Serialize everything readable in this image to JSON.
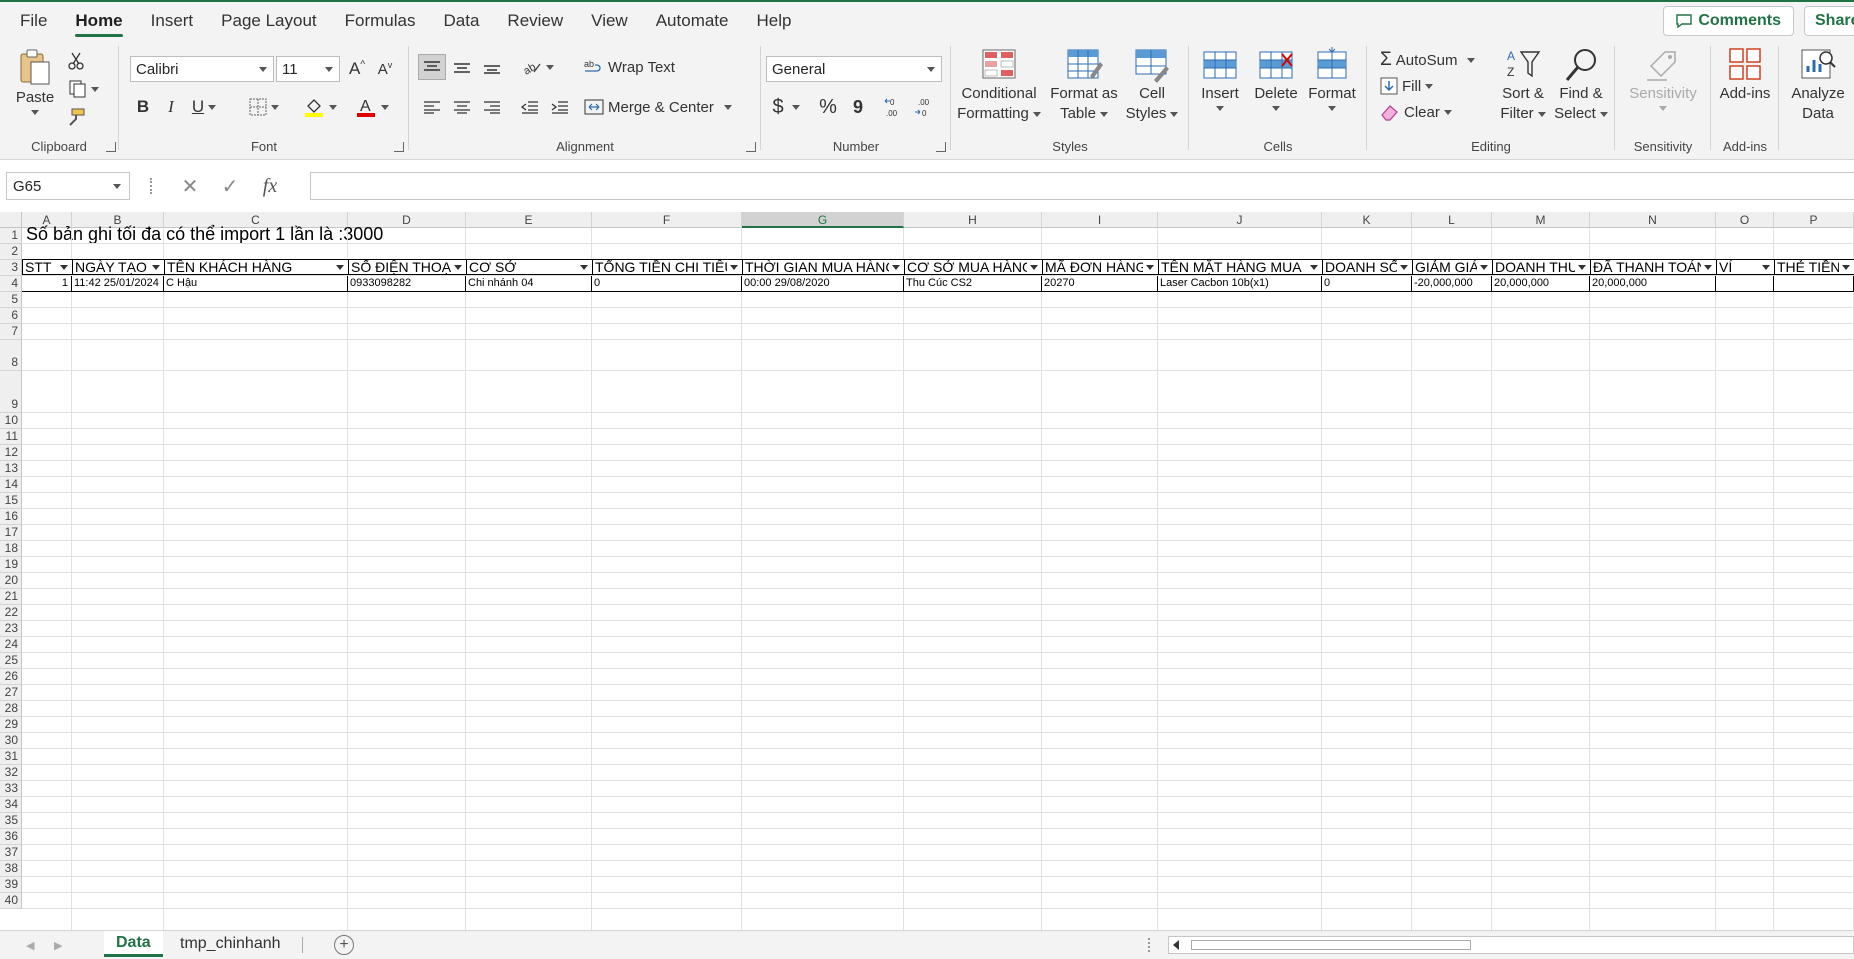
{
  "menu": {
    "tabs": [
      "File",
      "Home",
      "Insert",
      "Page Layout",
      "Formulas",
      "Data",
      "Review",
      "View",
      "Automate",
      "Help"
    ],
    "active_tab": "Home",
    "comments_label": "Comments",
    "share_label": "Share"
  },
  "ribbon": {
    "clipboard": {
      "paste": "Paste",
      "label": "Clipboard"
    },
    "font": {
      "name": "Calibri",
      "size": "11",
      "bold": "B",
      "italic": "I",
      "underline": "U",
      "label": "Font"
    },
    "alignment": {
      "wrap_text": "Wrap Text",
      "merge_center": "Merge & Center",
      "label": "Alignment"
    },
    "number": {
      "format": "General",
      "currency": "$",
      "percent": "%",
      "comma": "9",
      "label": "Number"
    },
    "styles": {
      "conditional_1": "Conditional",
      "conditional_2": "Formatting",
      "format_table_1": "Format as",
      "format_table_2": "Table",
      "cell_styles_1": "Cell",
      "cell_styles_2": "Styles",
      "label": "Styles"
    },
    "cells": {
      "insert": "Insert",
      "delete": "Delete",
      "format": "Format",
      "label": "Cells"
    },
    "editing": {
      "autosum": "AutoSum",
      "fill": "Fill",
      "clear": "Clear",
      "sort_1": "Sort &",
      "sort_2": "Filter",
      "find_1": "Find &",
      "find_2": "Select",
      "label": "Editing"
    },
    "sensitivity": {
      "button": "Sensitivity",
      "label": "Sensitivity"
    },
    "addins": {
      "button": "Add-ins",
      "label": "Add-ins"
    },
    "analyze": {
      "line1": "Analyze",
      "line2": "Data"
    }
  },
  "formula_bar": {
    "name_box": "G65",
    "fx": "fx",
    "content": ""
  },
  "sheet": {
    "columns": [
      "A",
      "B",
      "C",
      "D",
      "E",
      "F",
      "G",
      "H",
      "I",
      "J",
      "K",
      "L",
      "M",
      "N",
      "O",
      "P"
    ],
    "selected_column": "G",
    "rows": [
      "1",
      "2",
      "3",
      "4",
      "5",
      "6",
      "7",
      "8",
      "9",
      "10",
      "11",
      "12",
      "13",
      "14",
      "15",
      "16",
      "17",
      "18",
      "19",
      "20",
      "21",
      "22",
      "23",
      "24",
      "25",
      "26",
      "27",
      "28",
      "29",
      "30",
      "31",
      "32",
      "33",
      "34",
      "35",
      "36",
      "37",
      "38",
      "39",
      "40"
    ],
    "title": "Số bản ghi tối đa có thể import 1 lần là :3000",
    "headers": [
      "STT",
      "NGÀY TẠO",
      "TÊN KHÁCH HÀNG",
      "SỐ ĐIỆN THOẠI",
      "CƠ SỞ",
      "TỔNG TIỀN CHI TIÊU",
      "THỜI GIAN MUA HÀNG",
      "CƠ SỞ MUA HÀNG",
      "MÃ ĐƠN HÀNG",
      "TÊN MẶT HÀNG MUA",
      "DOANH SỐ",
      "GIẢM GIÁ",
      "DOANH THU",
      "ĐÃ THANH TOÁN",
      "VÍ",
      "THẺ TIỀN"
    ],
    "data_row": [
      "1",
      "11:42 25/01/2024",
      "C Hậu",
      "0933098282",
      "Chi nhánh 04",
      "0",
      "00:00 29/08/2020",
      "Thu Cúc CS2",
      "20270",
      "Laser Cacbon 10b(x1)",
      "0",
      "-20,000,000",
      "20,000,000",
      "20,000,000",
      "",
      ""
    ]
  },
  "sheet_tabs": {
    "tabs": [
      "Data",
      "tmp_chinhanh"
    ],
    "active": "Data"
  }
}
